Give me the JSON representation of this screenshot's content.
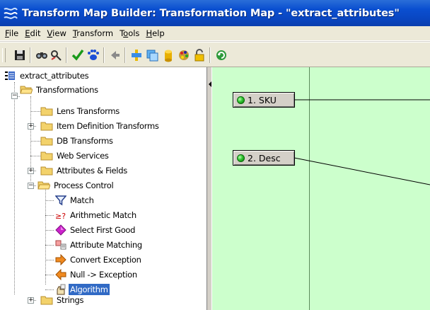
{
  "window": {
    "title": "Transform Map Builder:  Transformation Map - \"extract_attributes\""
  },
  "menu": [
    {
      "label": "File",
      "ul": "F",
      "rest": "ile"
    },
    {
      "label": "Edit",
      "ul": "E",
      "rest": "dit"
    },
    {
      "label": "View",
      "ul": "V",
      "rest": "iew"
    },
    {
      "label": "Transform",
      "ul": "T",
      "rest": "ransform"
    },
    {
      "label": "Tools",
      "ul": "T",
      "rest": "ools",
      "ul_index": 1
    },
    {
      "label": "Help",
      "ul": "H",
      "rest": "elp"
    }
  ],
  "toolbar": {
    "buttons": [
      "save-icon",
      "find-icon",
      "find-replace-icon",
      "validate-check-icon",
      "paw-run-icon",
      "back-arrow-icon",
      "transform-icon",
      "copy-icon",
      "database-icon",
      "palette-icon",
      "lock-icon",
      "refresh-icon"
    ]
  },
  "tree": {
    "root": "extract_attributes",
    "transformations": "Transformations",
    "lens_transforms": "Lens Transforms",
    "item_definition_transforms": "Item Definition Transforms",
    "db_transforms": "DB Transforms",
    "web_services": "Web Services",
    "attributes_fields": "Attributes & Fields",
    "process_control": "Process Control",
    "match": "Match",
    "arithmetic_match": "Arithmetic Match",
    "select_first_good": "Select First Good",
    "attribute_matching": "Attribute Matching",
    "convert_exception": "Convert Exception",
    "null_exception": "Null -> Exception",
    "algorithm": "Algorithm",
    "strings": "Strings",
    "selected": "Algorithm"
  },
  "canvas": {
    "background": "#ccffcc",
    "fields": [
      {
        "label": "1. SKU"
      },
      {
        "label": "2. Desc"
      }
    ]
  },
  "colors": {
    "titlebar": "#0a4fd0",
    "selection": "#316ac5",
    "canvas": "#ccffcc"
  }
}
